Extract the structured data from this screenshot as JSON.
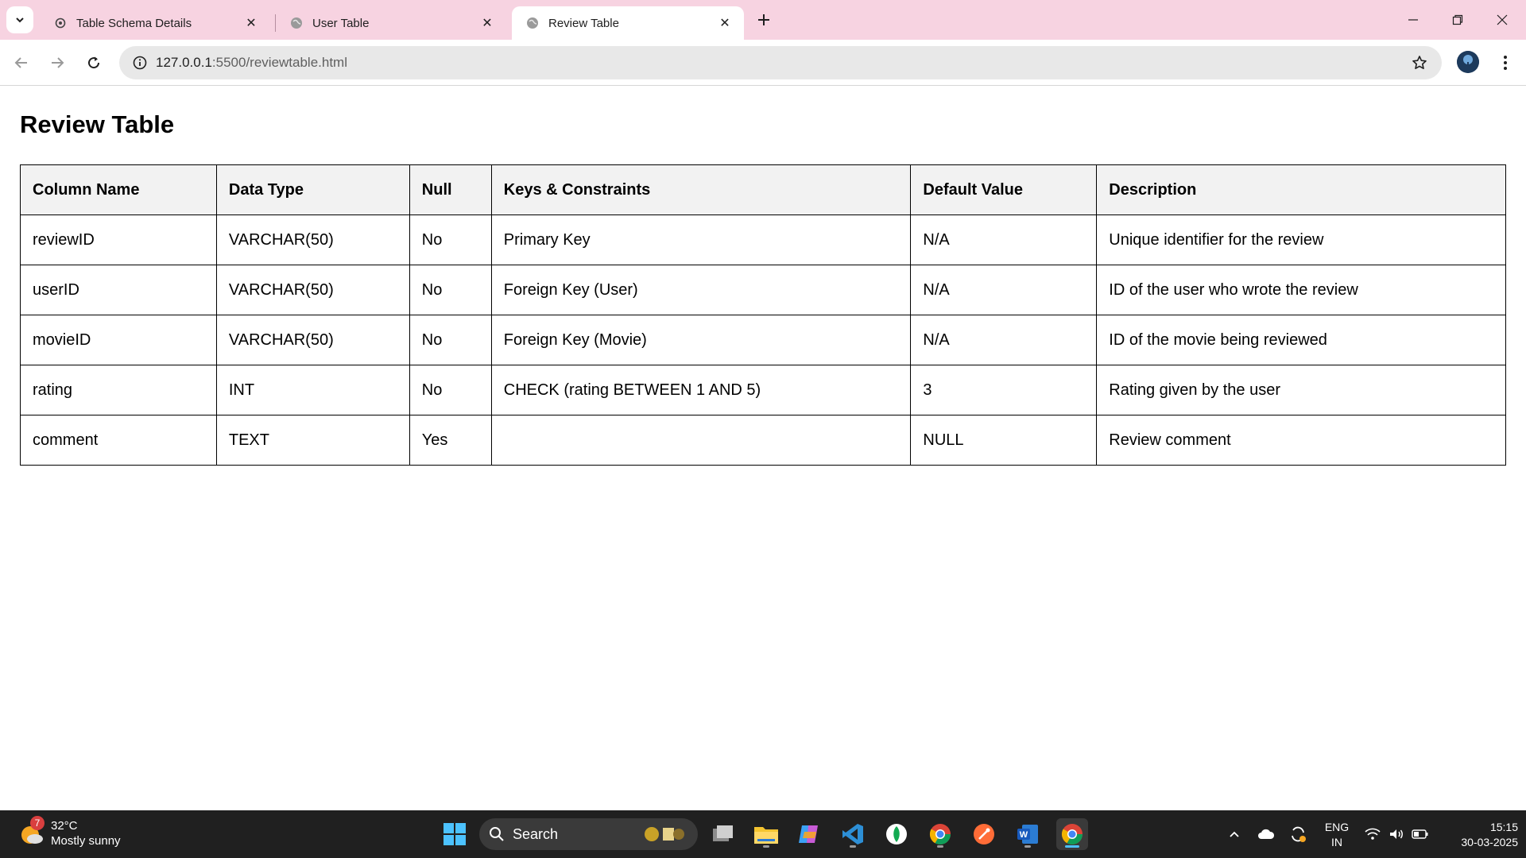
{
  "browser": {
    "tabs": [
      {
        "title": "Table Schema Details",
        "favicon": "gear-icon",
        "active": false
      },
      {
        "title": "User Table",
        "favicon": "globe-icon",
        "active": false
      },
      {
        "title": "Review Table",
        "favicon": "globe-icon",
        "active": true
      }
    ],
    "url_host": "127.0.0.1",
    "url_rest": ":5500/reviewtable.html",
    "tab_strip_color": "#f7d3e1"
  },
  "page": {
    "title": "Review Table",
    "table": {
      "headers": [
        "Column Name",
        "Data Type",
        "Null",
        "Keys & Constraints",
        "Default Value",
        "Description"
      ],
      "rows": [
        [
          "reviewID",
          "VARCHAR(50)",
          "No",
          "Primary Key",
          "N/A",
          "Unique identifier for the review"
        ],
        [
          "userID",
          "VARCHAR(50)",
          "No",
          "Foreign Key (User)",
          "N/A",
          "ID of the user who wrote the review"
        ],
        [
          "movieID",
          "VARCHAR(50)",
          "No",
          "Foreign Key (Movie)",
          "N/A",
          "ID of the movie being reviewed"
        ],
        [
          "rating",
          "INT",
          "No",
          "CHECK (rating BETWEEN 1 AND 5)",
          "3",
          "Rating given by the user"
        ],
        [
          "comment",
          "TEXT",
          "Yes",
          "",
          "NULL",
          "Review comment"
        ]
      ]
    }
  },
  "taskbar": {
    "weather": {
      "temp": "32°C",
      "condition": "Mostly sunny",
      "badge": "7"
    },
    "search_label": "Search",
    "lang_line1": "ENG",
    "lang_line2": "IN",
    "time": "15:15",
    "date": "30-03-2025"
  }
}
